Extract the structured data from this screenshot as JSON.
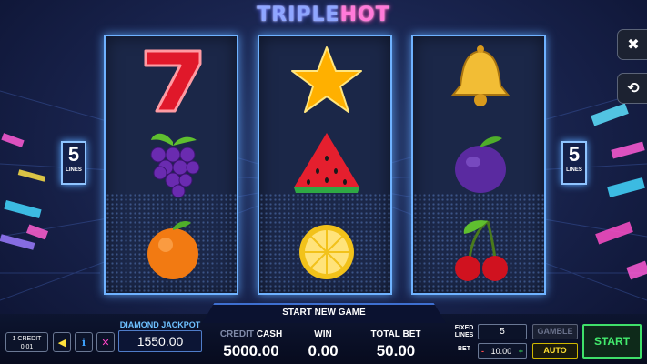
{
  "title": {
    "part1": "TRIPLE",
    "part2": "HOT"
  },
  "reels": [
    {
      "symbols": [
        "seven",
        "grapes",
        "orange"
      ]
    },
    {
      "symbols": [
        "star",
        "watermelon",
        "lemon"
      ]
    },
    {
      "symbols": [
        "bell",
        "plum",
        "cherries"
      ]
    }
  ],
  "lines_badge": {
    "count": "5",
    "label": "LINES"
  },
  "side_buttons": {
    "close_icon": "close-icon",
    "history_icon": "history-icon"
  },
  "status": "START NEW GAME",
  "credit": {
    "line1": "1 CREDIT",
    "line2": "0.01"
  },
  "jackpot": {
    "label": "DIAMOND JACKPOT",
    "value": "1550.00"
  },
  "cash": {
    "label_dim": "CREDIT",
    "label": "CASH",
    "value": "5000.00"
  },
  "win": {
    "label": "WIN",
    "value": "0.00"
  },
  "total_bet": {
    "label": "TOTAL BET",
    "value": "50.00"
  },
  "fixed_lines": {
    "label_1": "FIXED",
    "label_2": "LINES",
    "value": "5"
  },
  "bet": {
    "label": "BET",
    "minus": "-",
    "value": "10.00",
    "plus": "+"
  },
  "buttons": {
    "gamble": "GAMBLE",
    "auto": "AUTO",
    "start": "START"
  },
  "colors": {
    "reel_border": "#6fb2ff",
    "start": "#43ec6e",
    "auto": "#ffe032",
    "jackpot_label": "#6ec1ff"
  }
}
